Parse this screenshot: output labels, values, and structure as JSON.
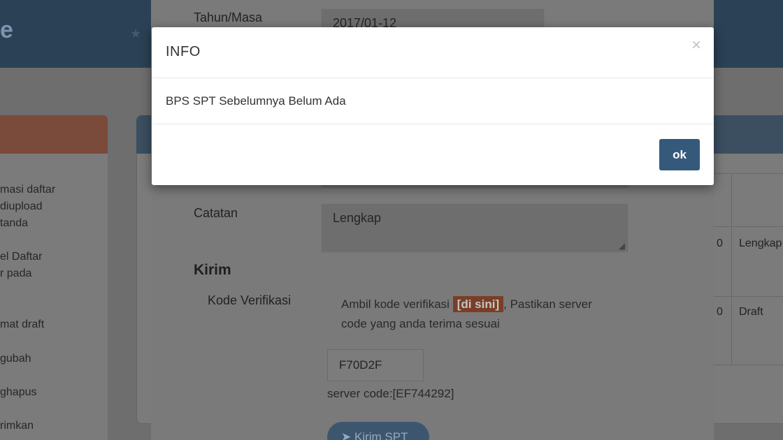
{
  "background": {
    "brand_fragment": "e",
    "star_icon": "star-icon",
    "sidebar_lines": [
      "masi daftar",
      "diupload",
      "tanda",
      "el Daftar",
      "r pada",
      "mat draft",
      "gubah",
      "ghapus",
      "rimkan"
    ],
    "table": {
      "row1_num": "0",
      "row1_status": "Lengkap",
      "row2_num": "0",
      "row2_status": "Draft"
    }
  },
  "form": {
    "tahun_masa_label": "Tahun/Masa",
    "tahun_masa_value": "2017/01-12",
    "catatan_label": "Catatan",
    "catatan_value": "Lengkap",
    "kirim_section": "Kirim",
    "kode_verifikasi_label": "Kode Verifikasi",
    "verif_text_before": "Ambil kode verifikasi",
    "verif_link": "[di sini]",
    "verif_text_after": ", Pastikan server code yang anda terima sesuai",
    "code_value": "F70D2F",
    "server_code": "server code:[EF744292]",
    "kirim_button": "Kirim SPT"
  },
  "modal": {
    "title": "INFO",
    "close_glyph": "×",
    "message": "BPS SPT Sebelumnya Belum Ada",
    "ok_label": "ok"
  },
  "colors": {
    "ok_button": "#34597b",
    "link_badge": "#e2683a"
  }
}
